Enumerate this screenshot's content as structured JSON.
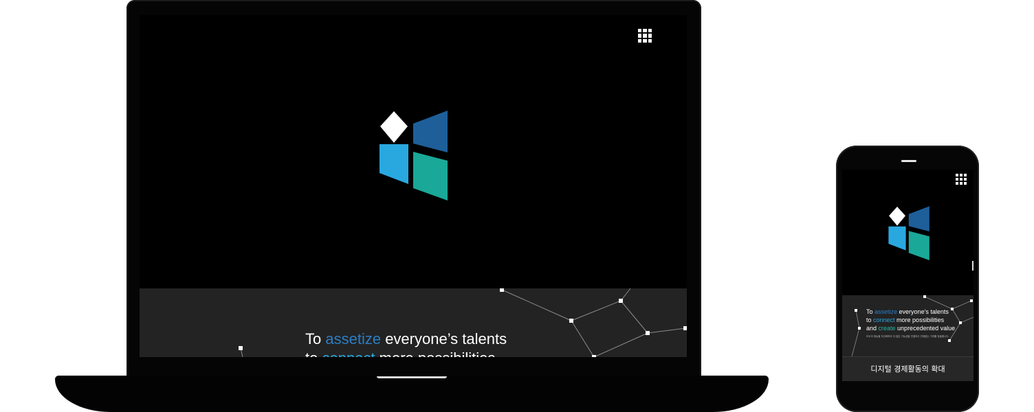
{
  "laptop": {
    "tagline": {
      "line1": {
        "pre": "To ",
        "accent": "assetize",
        "post": " everyone’s talents"
      },
      "line2": {
        "pre": "to ",
        "accent": "connect",
        "post": " more possibilities"
      }
    }
  },
  "phone": {
    "tagline": {
      "line1": {
        "pre": "To ",
        "accent": "assetize",
        "post": " everyone’s talents"
      },
      "line2": {
        "pre": "to ",
        "accent": "connect",
        "post": " more possibilities"
      },
      "line3": {
        "pre": "and ",
        "accent": "create",
        "post": " unprecedented value"
      }
    },
    "fine_print": "모두의 재능을 자산화하여 더 많은 가능성을 연결하고 전에없는 가치를 창출합니다.",
    "footer_label": "디지털 경제활동의 확대"
  },
  "icons": {
    "menu": "grid-menu-icon",
    "logo": "window-logo-icon"
  },
  "colors": {
    "logo_white": "#ffffff",
    "logo_dark_blue": "#1e5f9a",
    "logo_light_blue": "#29a8e0",
    "logo_teal": "#1aa898",
    "accent_assetize": "#2a7ec4",
    "accent_connect": "#29a8e0",
    "accent_create": "#2ab5a5",
    "band_bg": "#232323"
  }
}
